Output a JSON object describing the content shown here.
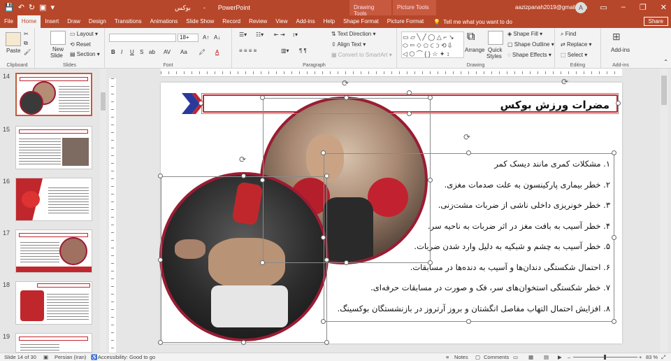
{
  "titlebar": {
    "doc_title": "بوکس",
    "app_name": "PowerPoint",
    "drawing_tools": "Drawing Tools",
    "picture_tools": "Picture Tools",
    "account": "aazizpanah2019@gmail.com",
    "avatar_letter": "A"
  },
  "tabs": [
    "File",
    "Home",
    "Insert",
    "Draw",
    "Design",
    "Transitions",
    "Animations",
    "Slide Show",
    "Record",
    "Review",
    "View",
    "Add-ins",
    "Help",
    "Shape Format",
    "Picture Format"
  ],
  "tell_me": "Tell me what you want to do",
  "share": "Share",
  "ribbon": {
    "clipboard": {
      "paste": "Paste",
      "label": "Clipboard"
    },
    "slides": {
      "new_slide": "New\nSlide",
      "new_slide_l1": "New",
      "new_slide_l2": "Slide",
      "layout": "Layout",
      "reset": "Reset",
      "section": "Section",
      "label": "Slides"
    },
    "font": {
      "size": "18+",
      "label": "Font",
      "buttons": [
        "B",
        "I",
        "U",
        "S",
        "ab",
        "AV",
        "Aa",
        "A"
      ]
    },
    "paragraph": {
      "text_direction": "Text Direction",
      "align_text": "Align Text",
      "convert_smartart": "Convert to SmartArt",
      "label": "Paragraph"
    },
    "drawing": {
      "arrange": "Arrange",
      "quick_styles": "Quick\nStyles",
      "qs_l1": "Quick",
      "qs_l2": "Styles",
      "shape_fill": "Shape Fill",
      "shape_outline": "Shape Outline",
      "shape_effects": "Shape Effects",
      "label": "Drawing"
    },
    "editing": {
      "find": "Find",
      "replace": "Replace",
      "select": "Select",
      "label": "Editing"
    },
    "addins": {
      "addins": "Add-ins",
      "label": "Add-ins"
    }
  },
  "thumbnails": [
    {
      "num": "14"
    },
    {
      "num": "15"
    },
    {
      "num": "16"
    },
    {
      "num": "17"
    },
    {
      "num": "18"
    },
    {
      "num": "19"
    }
  ],
  "slide": {
    "title": "مضرات ورزش بوکس",
    "items": [
      "۱. مشکلات کمری مانند دیسک کمر",
      "۲. خطر بیماری پارکینسون به علت صدمات مغزی.",
      "۳. خطر خونریزی داخلی ناشی از ضربات مشت‌زنی.",
      "۴. خطر آسیب به بافت مغز در اثر ضربات به ناحیه سر.",
      "۵. خطر آسیب به چشم و شبکیه به دلیل وارد شدن ضربات.",
      "۶. احتمال شکستگی دندان‌ها و آسیب به دنده‌ها در مسابقات.",
      "۷. خطر شکستگی استخوان‌های سر، فک و صورت در مسابقات حرفه‌ای.",
      "۸. افزایش احتمال التهاب مفاصل انگشتان و بروز آرتروز در بازنشستگان بوکسینگ."
    ]
  },
  "status": {
    "slide_info": "Slide 14 of 30",
    "language": "Persian (Iran)",
    "accessibility": "Accessibility: Good to go",
    "notes": "Notes",
    "comments": "Comments",
    "zoom": "83 %"
  },
  "colors": {
    "accent": "#b7472a",
    "frame": "#9a1c33",
    "title_border": "#c0272d",
    "chevron": "#2a3a9c"
  }
}
